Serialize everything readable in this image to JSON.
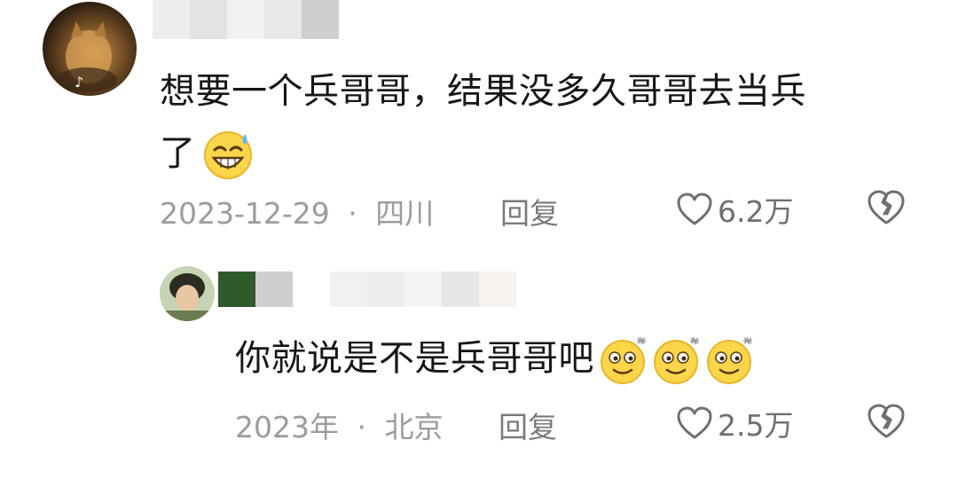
{
  "comments": [
    {
      "text_line1": "想要一个兵哥哥，结果没多久哥哥去当兵",
      "text_line2": "了",
      "emoji": "sweat-smile-emoji",
      "date": "2023-12-29",
      "separator": "·",
      "location": "四川",
      "reply_label": "回复",
      "likes": "6.2万"
    },
    {
      "text": "你就说是不是兵哥哥吧",
      "emoji": "dizzy-eyes-emoji",
      "emoji_count": 3,
      "date": "2023年",
      "separator": "·",
      "location": "北京",
      "reply_label": "回复",
      "likes": "2.5万"
    }
  ],
  "icons": {
    "like": "heart-outline-icon",
    "dislike": "broken-heart-icon"
  },
  "colors": {
    "text": "#161616",
    "meta": "#9c9c9c",
    "reply": "#7a7a7a",
    "emoji_fill": "#fbd54a"
  }
}
